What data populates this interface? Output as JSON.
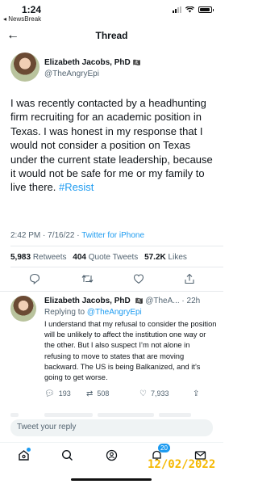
{
  "status": {
    "time": "1:24",
    "back_app": "◂ NewsBreak"
  },
  "nav": {
    "title": "Thread"
  },
  "tweet": {
    "author_name": "Elizabeth Jacobs, PhD",
    "author_handle": "@TheAngryEpi",
    "text": "I was recently contacted by a headhunting firm recruiting for an academic position in Texas. I was honest in my response that I would not consider a position on Texas under the current state leadership, because it would not be safe for me or my family to live there.",
    "hashtag": "#Resist",
    "timestamp": "2:42 PM · 7/16/22 · ",
    "source": "Twitter for iPhone",
    "retweets": "5,983",
    "retweets_label": "Retweets",
    "quotes": "404",
    "quotes_label": "Quote Tweets",
    "likes": "57.2K",
    "likes_label": "Likes"
  },
  "reply": {
    "author_name": "Elizabeth Jacobs, PhD",
    "author_handle": "@TheA...",
    "age": "· 22h",
    "replying_prefix": "Replying to",
    "replying_to": "@TheAngryEpi",
    "text": "I understand that my refusal to consider the position will be unlikely to affect the institution one way or the other. But I also suspect I’m not alone in refusing to move to states that are moving backward. The US is being Balkanized, and it’s going to get worse.",
    "replies": "193",
    "retweets": "508",
    "likes": "7,933"
  },
  "composer": {
    "placeholder": "Tweet your reply"
  },
  "tabbar": {
    "notifications_count": "20"
  },
  "overlay": {
    "date_stamp": "12/02/2022"
  },
  "colors": {
    "accent": "#1d9bf0",
    "text": "#0f1419",
    "muted": "#536471",
    "date_stamp": "#f5b800"
  }
}
